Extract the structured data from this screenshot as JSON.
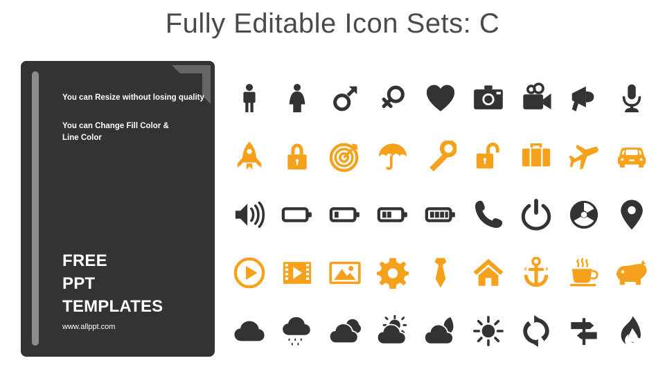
{
  "slide": {
    "title": "Fully Editable Icon Sets: C",
    "background_color": "#ffffff",
    "title_color": "#4a4a4a"
  },
  "info_panel": {
    "background_color": "#333333",
    "accent_bar_color": "#8c8c8c",
    "fold_corner_color": "#666666",
    "note_1": "You can Resize without losing quality",
    "note_2": "You can Change Fill Color &\nLine Color",
    "brand": "FREE\nPPT\nTEMPLATES",
    "url": "www.allppt.com"
  },
  "icon_grid": {
    "columns": 9,
    "rows": 5,
    "dark_color": "#333333",
    "orange_color": "#F5A11B",
    "icons": [
      {
        "name": "man-icon",
        "color": "#333333",
        "row": 1,
        "col": 1
      },
      {
        "name": "woman-icon",
        "color": "#333333",
        "row": 1,
        "col": 2
      },
      {
        "name": "male-symbol-icon",
        "color": "#333333",
        "row": 1,
        "col": 3
      },
      {
        "name": "female-symbol-icon",
        "color": "#333333",
        "row": 1,
        "col": 4
      },
      {
        "name": "heart-icon",
        "color": "#333333",
        "row": 1,
        "col": 5
      },
      {
        "name": "camera-icon",
        "color": "#333333",
        "row": 1,
        "col": 6
      },
      {
        "name": "video-camera-icon",
        "color": "#333333",
        "row": 1,
        "col": 7
      },
      {
        "name": "megaphone-icon",
        "color": "#333333",
        "row": 1,
        "col": 8
      },
      {
        "name": "microphone-icon",
        "color": "#333333",
        "row": 1,
        "col": 9
      },
      {
        "name": "rocket-icon",
        "color": "#F5A11B",
        "row": 2,
        "col": 1
      },
      {
        "name": "lock-closed-icon",
        "color": "#F5A11B",
        "row": 2,
        "col": 2
      },
      {
        "name": "target-icon",
        "color": "#F5A11B",
        "row": 2,
        "col": 3
      },
      {
        "name": "umbrella-icon",
        "color": "#F5A11B",
        "row": 2,
        "col": 4
      },
      {
        "name": "key-icon",
        "color": "#F5A11B",
        "row": 2,
        "col": 5
      },
      {
        "name": "lock-open-icon",
        "color": "#F5A11B",
        "row": 2,
        "col": 6
      },
      {
        "name": "briefcase-icon",
        "color": "#F5A11B",
        "row": 2,
        "col": 7
      },
      {
        "name": "airplane-icon",
        "color": "#F5A11B",
        "row": 2,
        "col": 8
      },
      {
        "name": "car-icon",
        "color": "#F5A11B",
        "row": 2,
        "col": 9
      },
      {
        "name": "speaker-volume-icon",
        "color": "#333333",
        "row": 3,
        "col": 1
      },
      {
        "name": "battery-empty-icon",
        "color": "#333333",
        "row": 3,
        "col": 2
      },
      {
        "name": "battery-low-icon",
        "color": "#333333",
        "row": 3,
        "col": 3
      },
      {
        "name": "battery-medium-icon",
        "color": "#333333",
        "row": 3,
        "col": 4
      },
      {
        "name": "battery-full-icon",
        "color": "#333333",
        "row": 3,
        "col": 5
      },
      {
        "name": "phone-icon",
        "color": "#333333",
        "row": 3,
        "col": 6
      },
      {
        "name": "power-icon",
        "color": "#333333",
        "row": 3,
        "col": 7
      },
      {
        "name": "radiation-icon",
        "color": "#333333",
        "row": 3,
        "col": 8
      },
      {
        "name": "location-pin-icon",
        "color": "#333333",
        "row": 3,
        "col": 9
      },
      {
        "name": "play-circle-icon",
        "color": "#F5A11B",
        "row": 4,
        "col": 1
      },
      {
        "name": "film-icon",
        "color": "#F5A11B",
        "row": 4,
        "col": 2
      },
      {
        "name": "image-icon",
        "color": "#F5A11B",
        "row": 4,
        "col": 3
      },
      {
        "name": "gear-icon",
        "color": "#F5A11B",
        "row": 4,
        "col": 4
      },
      {
        "name": "necktie-icon",
        "color": "#F5A11B",
        "row": 4,
        "col": 5
      },
      {
        "name": "home-icon",
        "color": "#F5A11B",
        "row": 4,
        "col": 6
      },
      {
        "name": "anchor-icon",
        "color": "#F5A11B",
        "row": 4,
        "col": 7
      },
      {
        "name": "coffee-cup-icon",
        "color": "#F5A11B",
        "row": 4,
        "col": 8
      },
      {
        "name": "pig-icon",
        "color": "#F5A11B",
        "row": 4,
        "col": 9
      },
      {
        "name": "cloud-icon",
        "color": "#333333",
        "row": 5,
        "col": 1
      },
      {
        "name": "cloud-rain-icon",
        "color": "#333333",
        "row": 5,
        "col": 2
      },
      {
        "name": "clouds-icon",
        "color": "#333333",
        "row": 5,
        "col": 3
      },
      {
        "name": "cloud-sun-icon",
        "color": "#333333",
        "row": 5,
        "col": 4
      },
      {
        "name": "cloud-moon-icon",
        "color": "#333333",
        "row": 5,
        "col": 5
      },
      {
        "name": "sun-icon",
        "color": "#333333",
        "row": 5,
        "col": 6
      },
      {
        "name": "refresh-icon",
        "color": "#333333",
        "row": 5,
        "col": 7
      },
      {
        "name": "signpost-icon",
        "color": "#333333",
        "row": 5,
        "col": 8
      },
      {
        "name": "flame-icon",
        "color": "#333333",
        "row": 5,
        "col": 9
      }
    ]
  }
}
